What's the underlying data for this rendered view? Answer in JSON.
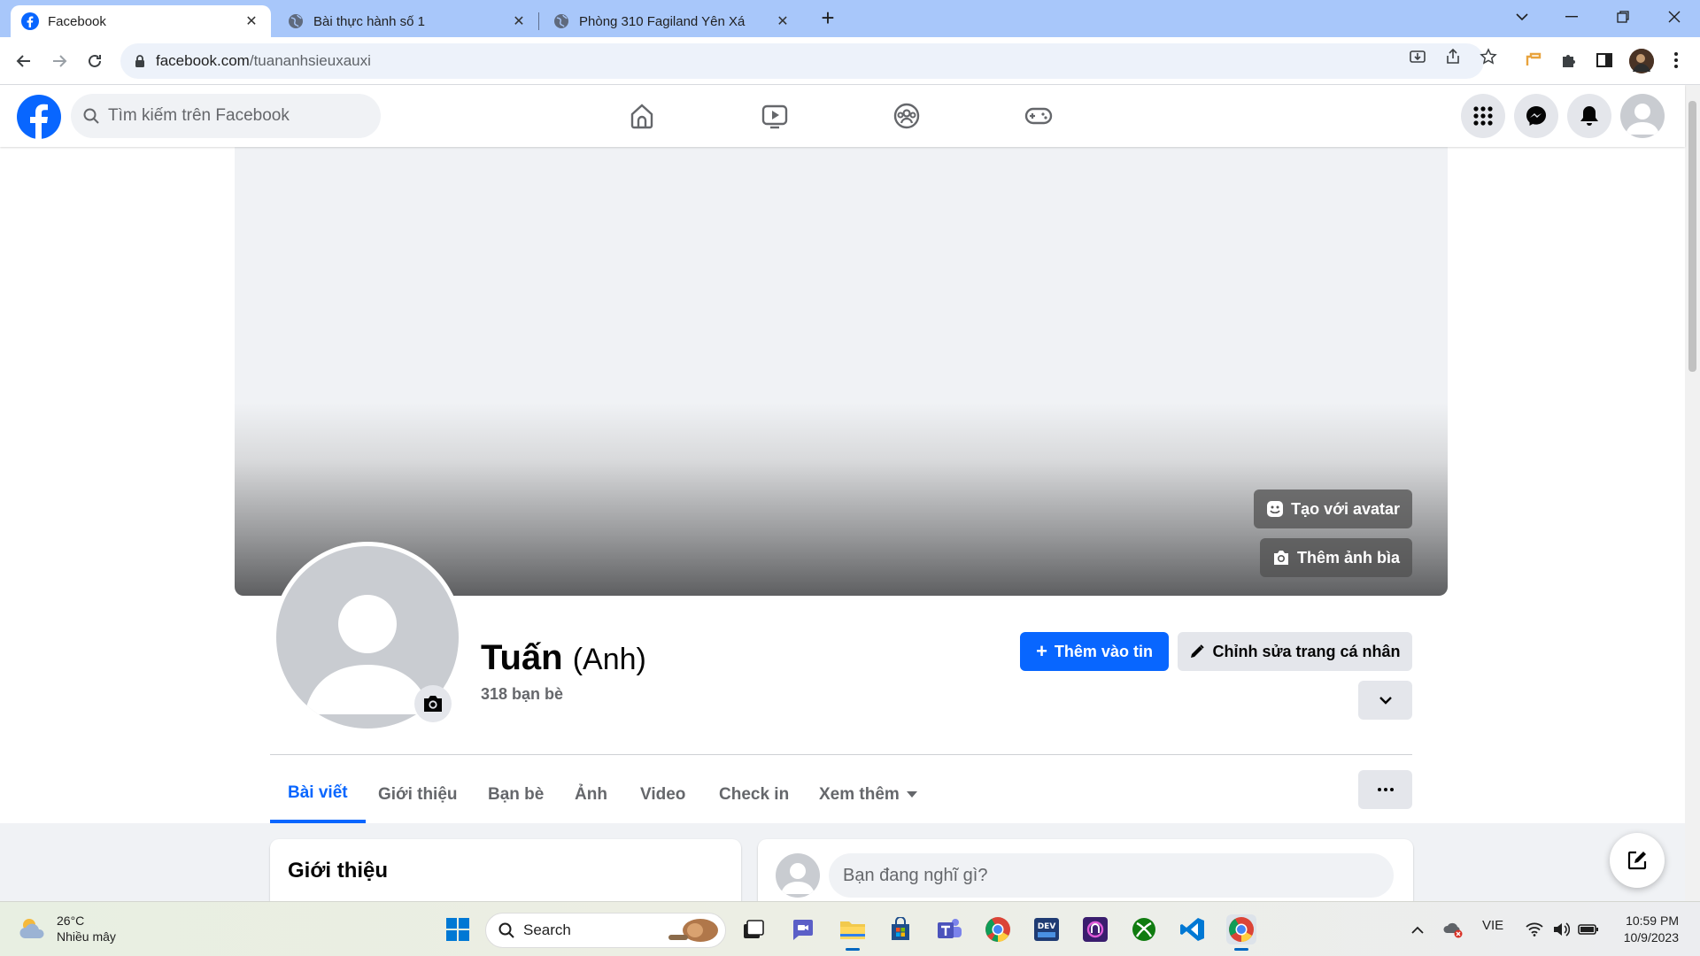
{
  "browser": {
    "tabs": [
      {
        "title": "Facebook",
        "active": true
      },
      {
        "title": "Bài thực hành số 1",
        "active": false
      },
      {
        "title": "Phòng 310 Fagiland Yên Xá",
        "active": false
      }
    ],
    "url_host": "facebook.com",
    "url_path": "/tuananhsieuxauxi"
  },
  "fb": {
    "search_placeholder": "Tìm kiếm trên Facebook",
    "nav_icons": [
      "home-icon",
      "watch-icon",
      "groups-icon",
      "gaming-icon"
    ],
    "right_icons": [
      "menu-grid-icon",
      "messenger-icon",
      "notifications-icon",
      "account-icon"
    ],
    "brand_color": "#0866ff"
  },
  "profile": {
    "name": "Tuấn",
    "alt_name": "(Anh)",
    "friends": "318 bạn bè",
    "cover_avatar_button": "Tạo với avatar",
    "cover_photo_button": "Thêm ảnh bìa",
    "add_story_button": "Thêm vào tin",
    "edit_profile_button": "Chỉnh sửa trang cá nhân",
    "tabs": [
      "Bài viết",
      "Giới thiệu",
      "Bạn bè",
      "Ảnh",
      "Video",
      "Check in",
      "Xem thêm"
    ],
    "active_tab": "Bài viết"
  },
  "intro_card": {
    "title": "Giới thiệu"
  },
  "composer": {
    "placeholder": "Bạn đang nghĩ gì?"
  },
  "taskbar": {
    "temperature": "26°C",
    "weather": "Nhiều mây",
    "search_label": "Search",
    "language": "VIE",
    "time": "10:59 PM",
    "date": "10/9/2023"
  }
}
